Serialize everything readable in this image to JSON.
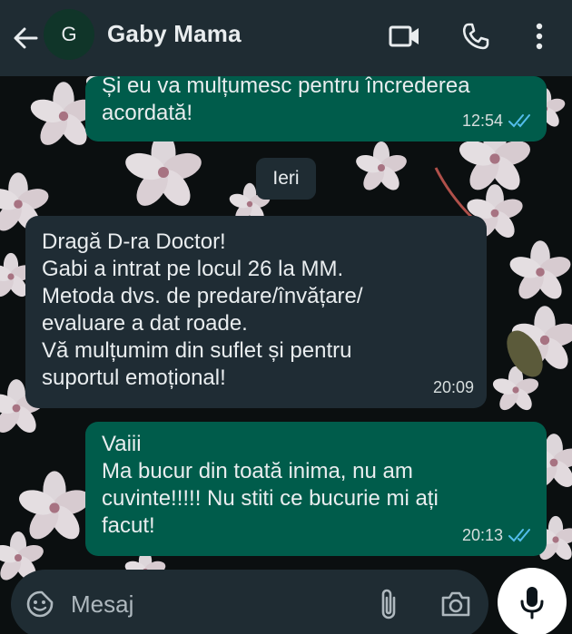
{
  "colors": {
    "header_bg": "#1f2c33",
    "outgoing_bubble": "#005c4b",
    "incoming_bubble": "#1f2c34",
    "read_tick": "#53bdeb",
    "background": "#0b0f10"
  },
  "header": {
    "avatar_letter": "G",
    "contact_name": "Gaby Mama",
    "icons": [
      "back-arrow-icon",
      "video-call-icon",
      "phone-icon",
      "more-vertical-icon"
    ]
  },
  "messages": [
    {
      "direction": "outgoing",
      "text": "Și eu va mulțumesc pentru încrederea\nacordată!",
      "time": "12:54",
      "status": "read"
    },
    {
      "direction": "incoming",
      "text": "Dragă D-ra Doctor!\nGabi a intrat pe locul 26 la MM.\nMetoda dvs. de predare/învățare/\nevaluare a dat roade.\nVă mulțumim din suflet și  pentru\nsuportul emoțional!",
      "time": "20:09"
    },
    {
      "direction": "outgoing",
      "text": "Vaiii\nMa bucur din toată inima, nu am\ncuvinte!!!!! Nu stiti ce bucurie mi ați\nfacut!",
      "time": "20:13",
      "status": "read"
    }
  ],
  "date_divider": "Ieri",
  "composer": {
    "placeholder": "Mesaj",
    "icons": [
      "emoji-sticker-icon",
      "paperclip-icon",
      "camera-icon",
      "microphone-icon"
    ]
  }
}
